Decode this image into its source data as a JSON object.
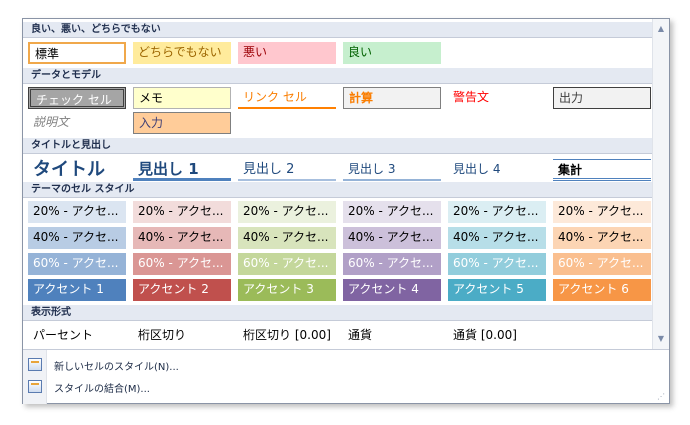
{
  "sections": [
    {
      "title": "良い、悪い、どちらでもない",
      "cells": [
        {
          "label": "標準",
          "bg": "#ffffff",
          "color": "#000000",
          "border": "#f0a84b",
          "style": "selected"
        },
        {
          "label": "どちらでもない",
          "bg": "#ffeb9c",
          "color": "#9c6500"
        },
        {
          "label": "悪い",
          "bg": "#ffc7ce",
          "color": "#9c0006"
        },
        {
          "label": "良い",
          "bg": "#c6efce",
          "color": "#006100"
        }
      ]
    },
    {
      "title": "データとモデル",
      "cells": [
        {
          "label": "チェック セル",
          "bg": "#a5a5a5",
          "color": "#ffffff",
          "border": "#3f3f3f",
          "style": "check"
        },
        {
          "label": "メモ",
          "bg": "#ffffcc",
          "color": "#000000",
          "border": "#b2b2b2"
        },
        {
          "label": "リンク セル",
          "bg": "#ffffff",
          "color": "#fa7d00",
          "underline": "#ff8001"
        },
        {
          "label": "計算",
          "bg": "#f2f2f2",
          "color": "#fa7d00",
          "border": "#7f7f7f",
          "bold": true
        },
        {
          "label": "警告文",
          "bg": "#ffffff",
          "color": "#ff0000"
        },
        {
          "label": "出力",
          "bg": "#f2f2f2",
          "color": "#3f3f3f",
          "border": "#3f3f3f"
        },
        {
          "label": "説明文",
          "bg": "#ffffff",
          "color": "#7f7f7f",
          "italic": true
        },
        {
          "label": "入力",
          "bg": "#ffcc99",
          "color": "#3f3f76",
          "border": "#7f7f7f"
        }
      ]
    },
    {
      "title": "タイトルと見出し",
      "cells": [
        {
          "label": "タイトル",
          "color": "#1f497d",
          "size": 18,
          "bold": true
        },
        {
          "label": "見出し 1",
          "color": "#1f497d",
          "size": 15,
          "bold": true,
          "underline": "#4f81bd"
        },
        {
          "label": "見出し 2",
          "color": "#1f497d",
          "size": 13,
          "underline": "#a7bfde"
        },
        {
          "label": "見出し 3",
          "color": "#1f497d",
          "size": 12,
          "underline": "#95b3d7"
        },
        {
          "label": "見出し 4",
          "color": "#1f497d",
          "size": 12
        },
        {
          "label": "集計",
          "color": "#000000",
          "size": 12,
          "bold": true,
          "topline": "#4f81bd",
          "bottomline": "#4f81bd"
        }
      ]
    },
    {
      "title": "テーマのセル スタイル",
      "rows": [
        {
          "labels": [
            "20% - アクセ...",
            "20% - アクセ...",
            "20% - アクセ...",
            "20% - アクセ...",
            "20% - アクセ...",
            "20% - アクセ..."
          ],
          "bgs": [
            "#dbe5f1",
            "#f2dcdb",
            "#ebf1de",
            "#e5e0ec",
            "#dbeef3",
            "#fde9d9"
          ],
          "color": "#000000"
        },
        {
          "labels": [
            "40% - アクセ...",
            "40% - アクセ...",
            "40% - アクセ...",
            "40% - アクセ...",
            "40% - アクセ...",
            "40% - アクセ..."
          ],
          "bgs": [
            "#b8cce4",
            "#e6b8b7",
            "#d8e4bc",
            "#ccc0da",
            "#b7dee8",
            "#fcd5b4"
          ],
          "color": "#000000"
        },
        {
          "labels": [
            "60% - アクセ...",
            "60% - アクセ...",
            "60% - アクセ...",
            "60% - アクセ...",
            "60% - アクセ...",
            "60% - アクセ..."
          ],
          "bgs": [
            "#95b3d7",
            "#da9694",
            "#c4d79b",
            "#b1a0c7",
            "#92cddc",
            "#fabf8f"
          ],
          "color": "#ffffff"
        },
        {
          "labels": [
            "アクセント 1",
            "アクセント 2",
            "アクセント 3",
            "アクセント 4",
            "アクセント 5",
            "アクセント 6"
          ],
          "bgs": [
            "#4f81bd",
            "#c0504d",
            "#9bbb59",
            "#8064a2",
            "#4bacc6",
            "#f79646"
          ],
          "color": "#ffffff"
        }
      ]
    },
    {
      "title": "表示形式",
      "cells": [
        {
          "label": "パーセント"
        },
        {
          "label": "桁区切り"
        },
        {
          "label": "桁区切り [0.00]"
        },
        {
          "label": "通貨"
        },
        {
          "label": "通貨 [0.00]"
        }
      ]
    }
  ],
  "menu": [
    {
      "label": "新しいセルのスタイル(N)...",
      "icon": "new-style-icon"
    },
    {
      "label": "スタイルの結合(M)...",
      "icon": "merge-styles-icon"
    }
  ],
  "scrollbar": {
    "up_icon": "scroll-up-arrow-icon",
    "down_icon": "scroll-down-arrow-icon"
  }
}
